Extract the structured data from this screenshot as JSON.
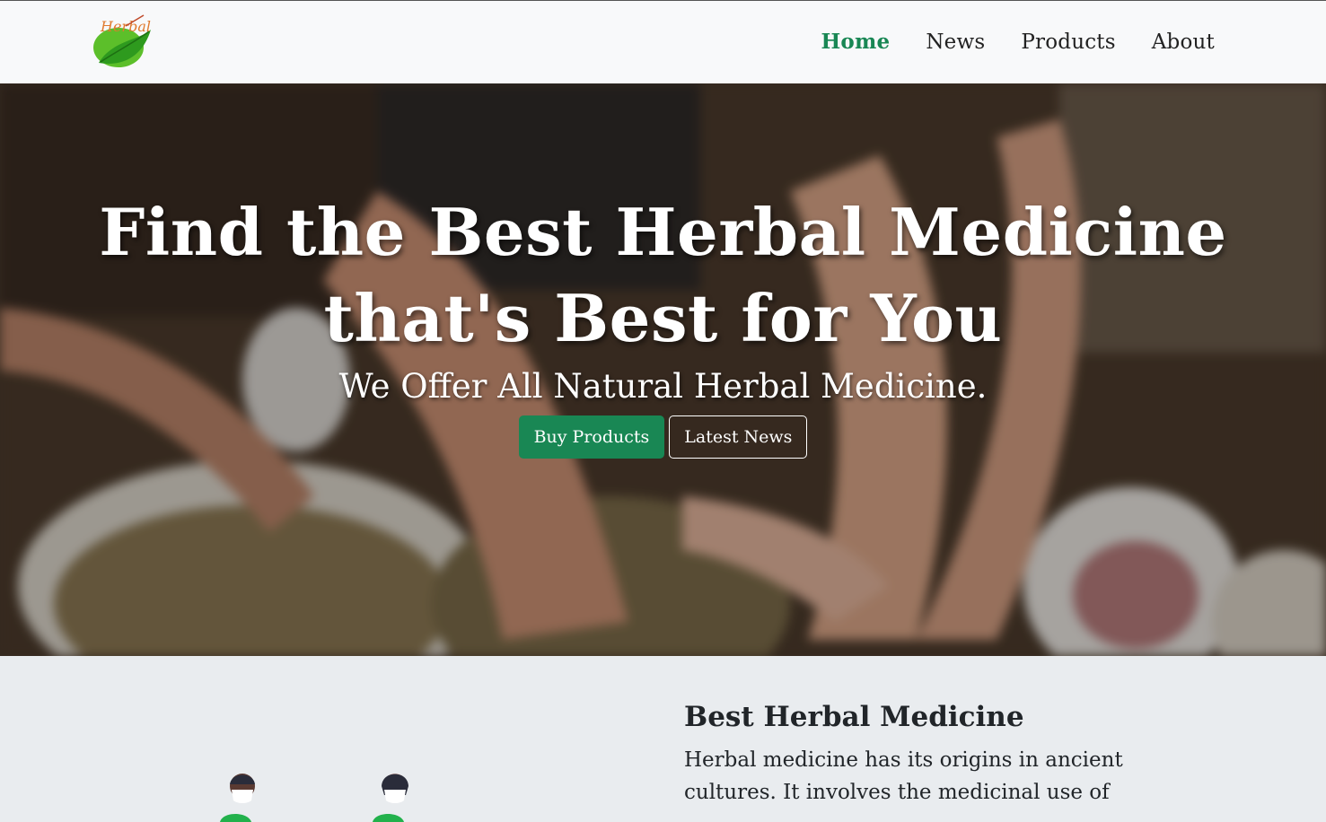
{
  "brand": {
    "logo_text": "Herbal",
    "logo_icon": "leaf-icon",
    "accent": "#198754"
  },
  "nav": {
    "items": [
      {
        "label": "Home",
        "active": true
      },
      {
        "label": "News",
        "active": false
      },
      {
        "label": "Products",
        "active": false
      },
      {
        "label": "About",
        "active": false
      }
    ]
  },
  "hero": {
    "title_line1": "Find the Best Herbal Medicine",
    "title_line2": "that's Best for You",
    "subtitle": "We Offer All Natural Herbal Medicine.",
    "primary_button": "Buy Products",
    "secondary_button": "Latest News"
  },
  "about": {
    "title": "Best Herbal Medicine",
    "body": "Herbal medicine has its origins in ancient cultures. It involves the medicinal use of"
  }
}
